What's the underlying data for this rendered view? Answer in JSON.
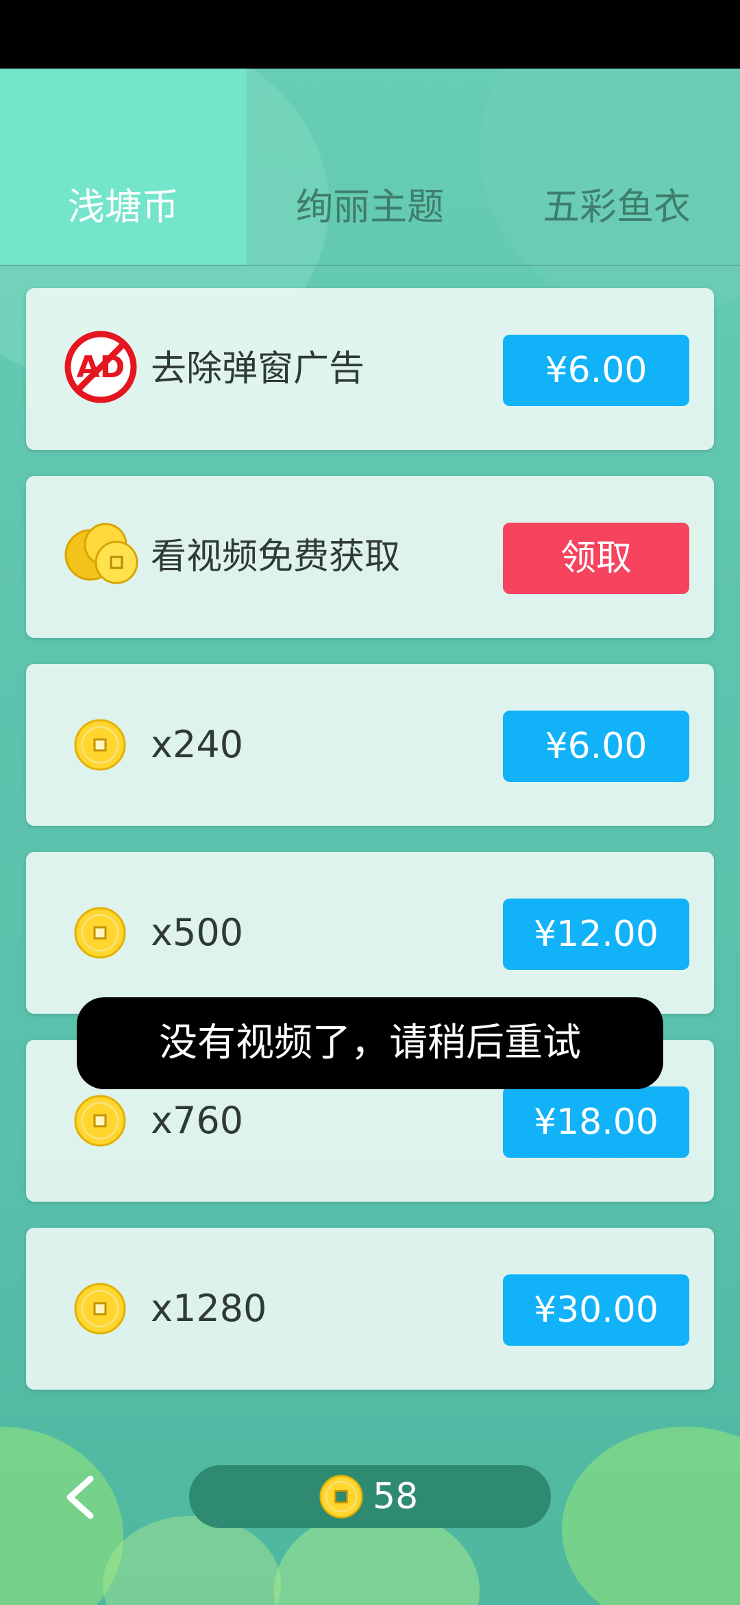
{
  "tabs": [
    {
      "label": "浅塘币",
      "active": true
    },
    {
      "label": "绚丽主题",
      "active": false
    },
    {
      "label": "五彩鱼衣",
      "active": false
    }
  ],
  "items": [
    {
      "icon": "no-ad-icon",
      "label": "去除弹窗广告",
      "button": "¥6.00",
      "button_color": "#12b2f8"
    },
    {
      "icon": "coins-stack-icon",
      "label": "看视频免费获取",
      "button": "领取",
      "button_color": "#f6445e"
    },
    {
      "icon": "coin-icon",
      "label": "x240",
      "button": "¥6.00",
      "button_color": "#12b2f8"
    },
    {
      "icon": "coin-icon",
      "label": "x500",
      "button": "¥12.00",
      "button_color": "#12b2f8"
    },
    {
      "icon": "coin-icon",
      "label": "x760",
      "button": "¥18.00",
      "button_color": "#12b2f8"
    },
    {
      "icon": "coin-icon",
      "label": "x1280",
      "button": "¥30.00",
      "button_color": "#12b2f8"
    }
  ],
  "toast": "没有视频了，请稍后重试",
  "footer": {
    "back_icon": "chevron-left-icon",
    "coin_icon": "coin-icon",
    "balance": "58"
  },
  "colors": {
    "accent_blue": "#12b2f8",
    "accent_red": "#f6445e",
    "tab_active_bg": "#74e8cc",
    "balance_bg": "#2f8a72"
  }
}
